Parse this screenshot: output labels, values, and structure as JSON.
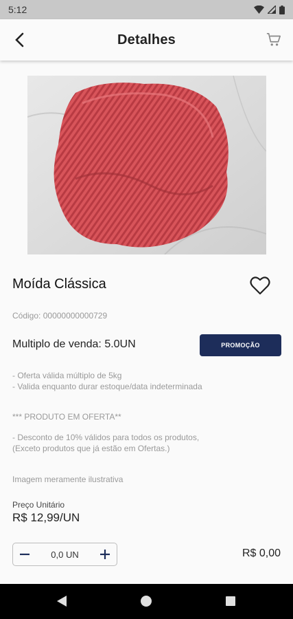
{
  "status_bar": {
    "time": "5:12"
  },
  "app_bar": {
    "title": "Detalhes"
  },
  "product": {
    "name": "Moída Clássica",
    "code_label": "Código:",
    "code_value": "00000000000729",
    "multiple_label": "Multiplo de venda:",
    "multiple_value": "5.0UN",
    "promo_badge": "PROMOÇÃO",
    "description_lines": [
      "- Oferta válida múltiplo de 5kg",
      "- Valida enquanto durar estoque/data indeterminada",
      "*** PRODUTO EM OFERTA**",
      "- Desconto de 10% válidos para todos os produtos,",
      "(Exceto produtos que já estão em Ofertas.)",
      "Imagem meramente ilustrativa"
    ],
    "price_label": "Preço Unitário",
    "price_value": "R$ 12,99/UN"
  },
  "cart": {
    "quantity": "0,0 UN",
    "total": "R$ 0,00"
  },
  "colors": {
    "accent": "#1d2d5a",
    "meat": "#d8545a",
    "background": "#fafafa"
  },
  "icons": {
    "back": "arrow-back-icon",
    "cart": "shopping-cart-icon",
    "favorite": "heart-outline-icon",
    "minus": "minus-icon",
    "plus": "plus-icon"
  }
}
